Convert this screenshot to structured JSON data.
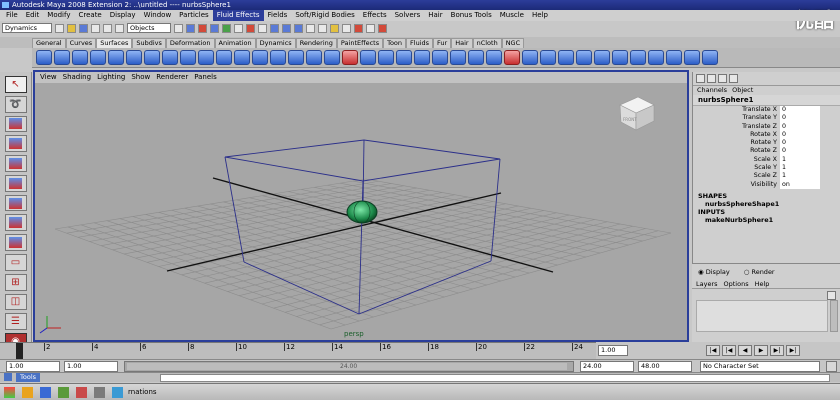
{
  "window": {
    "title": "Autodesk Maya 2008 Extension 2: ..\\untitled   ----   nurbsSphere1",
    "watermark": "优酷"
  },
  "menubar": {
    "items": [
      "File",
      "Edit",
      "Modify",
      "Create",
      "Display",
      "Window",
      "Particles",
      "Fluid Effects",
      "Fields",
      "Soft/Rigid Bodies",
      "Effects",
      "Solvers",
      "Hair",
      "Bonus Tools",
      "Muscle",
      "Help"
    ],
    "highlighted": "Fluid Effects"
  },
  "statusline": {
    "menuset": "Dynamics",
    "selection_mode": "Objects"
  },
  "shelf": {
    "tabs": [
      "General",
      "Curves",
      "Surfaces",
      "Subdivs",
      "Deformation",
      "Animation",
      "Dynamics",
      "Rendering",
      "PaintEffects",
      "Toon",
      "Fluids",
      "Fur",
      "Hair",
      "nCloth",
      "NGC"
    ],
    "active_tab": "Surfaces"
  },
  "viewport": {
    "menu": [
      "View",
      "Shading",
      "Lighting",
      "Show",
      "Renderer",
      "Panels"
    ],
    "camera_label": "persp",
    "viewcube_label": "FRONT"
  },
  "channel_box": {
    "tabs": [
      "Channels",
      "Object"
    ],
    "object_name": "nurbsSphere1",
    "attributes": [
      {
        "name": "Translate X",
        "value": "0"
      },
      {
        "name": "Translate Y",
        "value": "0"
      },
      {
        "name": "Translate Z",
        "value": "0"
      },
      {
        "name": "Rotate X",
        "value": "0"
      },
      {
        "name": "Rotate Y",
        "value": "0"
      },
      {
        "name": "Rotate Z",
        "value": "0"
      },
      {
        "name": "Scale X",
        "value": "1"
      },
      {
        "name": "Scale Y",
        "value": "1"
      },
      {
        "name": "Scale Z",
        "value": "1"
      },
      {
        "name": "Visibility",
        "value": "on"
      }
    ],
    "shapes_header": "SHAPES",
    "shape_name": "nurbsSphereShape1",
    "inputs_header": "INPUTS",
    "input_name": "makeNurbSphere1"
  },
  "layer_editor": {
    "display_option": "Display",
    "render_option": "Render",
    "menu": [
      "Layers",
      "Options",
      "Help"
    ]
  },
  "time_slider": {
    "tick_labels": [
      "2",
      "4",
      "6",
      "8",
      "10",
      "12",
      "14",
      "16",
      "18",
      "20",
      "22",
      "24"
    ],
    "current_frame": "1.00"
  },
  "range_slider": {
    "start_time": "1.00",
    "playback_start": "1.00",
    "playback_end": "24.00",
    "range_label": "24.00",
    "end_time": "48.00",
    "character_set": "No Character Set"
  },
  "status_bar": {
    "label": "Tools",
    "taskbar_text": "rnations"
  }
}
